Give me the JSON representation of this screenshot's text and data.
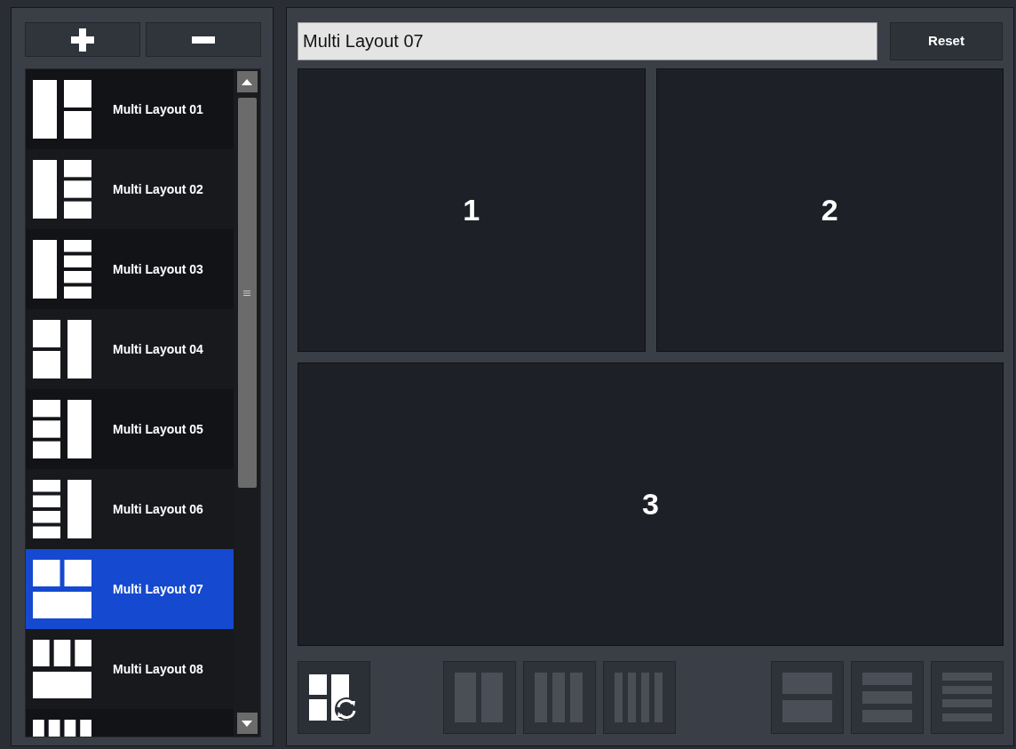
{
  "layouts": [
    {
      "label": "Multi Layout 01",
      "kind": "l01",
      "selected": false
    },
    {
      "label": "Multi Layout 02",
      "kind": "l02",
      "selected": false
    },
    {
      "label": "Multi Layout 03",
      "kind": "l03",
      "selected": false
    },
    {
      "label": "Multi Layout 04",
      "kind": "l04",
      "selected": false
    },
    {
      "label": "Multi Layout 05",
      "kind": "l05",
      "selected": false
    },
    {
      "label": "Multi Layout 06",
      "kind": "l06",
      "selected": false
    },
    {
      "label": "Multi Layout 07",
      "kind": "l07",
      "selected": true
    },
    {
      "label": "Multi Layout 08",
      "kind": "l08",
      "selected": false
    },
    {
      "kind": "l09",
      "selected": false
    }
  ],
  "name_field": {
    "value": "Multi Layout 07"
  },
  "reset_button": {
    "label": "Reset"
  },
  "panes": [
    {
      "label": "1"
    },
    {
      "label": "2"
    },
    {
      "label": "3"
    }
  ],
  "toolbar": [
    {
      "kind": "swap",
      "disabled": false
    },
    {
      "kind": "cols2",
      "disabled": true
    },
    {
      "kind": "cols3",
      "disabled": true
    },
    {
      "kind": "cols4",
      "disabled": true
    },
    {
      "kind": "rows2",
      "disabled": true
    },
    {
      "kind": "rows3",
      "disabled": true
    },
    {
      "kind": "rows4",
      "disabled": true
    }
  ]
}
